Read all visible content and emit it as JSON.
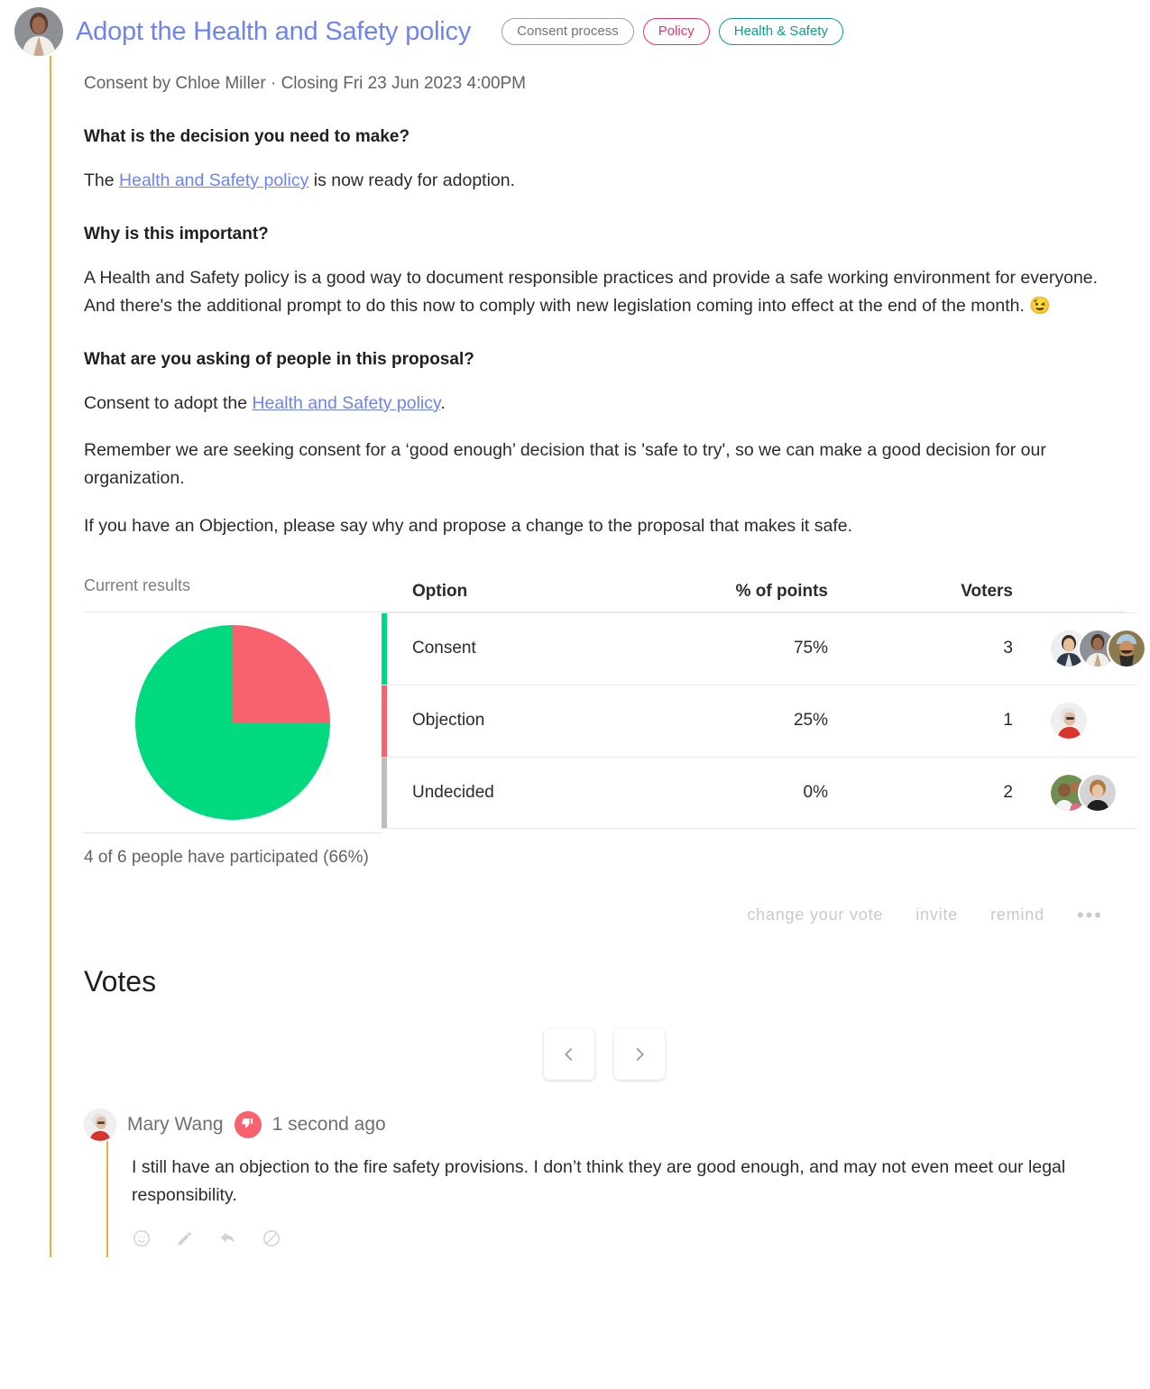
{
  "header": {
    "title": "Adopt the Health and Safety policy",
    "author_avatar": "woman-in-white-blazer-avatar",
    "tags": [
      {
        "label": "Consent process",
        "style": "gray"
      },
      {
        "label": "Policy",
        "style": "pink"
      },
      {
        "label": "Health & Safety",
        "style": "teal"
      }
    ]
  },
  "meta": "Consent by Chloe Miller · Closing Fri 23 Jun 2023 4:00PM",
  "content": {
    "q1_heading": "What is the decision you need to make?",
    "p1_before": "The ",
    "p1_link": "Health and Safety policy",
    "p1_after": " is now ready for adoption.",
    "q2_heading": "Why is this important?",
    "p2": "A Health and Safety policy is a good way to document responsible practices and provide a safe working environment for everyone. And there's the additional prompt to do this now to comply with new legislation coming into effect at the end of the month. ",
    "p2_emoji": "😉",
    "q3_heading": "What are you asking of people in this proposal?",
    "p3_before": "Consent to adopt the ",
    "p3_link": "Health and Safety policy",
    "p3_after": ".",
    "p4": "Remember we are seeking consent for a ‘good enough’ decision that is 'safe to try', so we can make a good decision for our organization.",
    "p5": "If you have an Objection, please say why and propose a change to the proposal that makes it safe."
  },
  "results": {
    "label": "Current results",
    "columns": {
      "option": "Option",
      "percent": "% of points",
      "voters": "Voters"
    },
    "rows": [
      {
        "option": "Consent",
        "percent": "75%",
        "voters": "3",
        "color": "#00d97e",
        "avatars": [
          "asian-man-avatar",
          "woman-in-white-blazer-avatar",
          "man-with-turban-avatar"
        ]
      },
      {
        "option": "Objection",
        "percent": "25%",
        "voters": "1",
        "color": "#f8616e",
        "avatars": [
          "older-woman-with-glasses-avatar"
        ]
      },
      {
        "option": "Undecided",
        "percent": "0%",
        "voters": "2",
        "color": "#bdbdbd",
        "avatars": [
          "man-with-child-avatar",
          "short-haired-woman-avatar"
        ]
      }
    ],
    "participation": "4 of 6 people have participated (66%)",
    "actions": [
      {
        "label": "change your vote",
        "name": "change-your-vote-button"
      },
      {
        "label": "invite",
        "name": "invite-button"
      },
      {
        "label": "remind",
        "name": "remind-button"
      }
    ],
    "more_label": "•••"
  },
  "chart_data": {
    "type": "pie",
    "title": "Current results",
    "labels": [
      "Consent",
      "Objection",
      "Undecided"
    ],
    "values": [
      75,
      25,
      0
    ],
    "colors": [
      "#00d97e",
      "#f8616e",
      "#bdbdbd"
    ],
    "unit": "% of points",
    "voter_counts": [
      3,
      1,
      2
    ],
    "legend": "table",
    "start_angle_deg": 0,
    "direction": "counterclockwise",
    "participation_count": 4,
    "participation_total": 6,
    "participation_pct": 66
  },
  "votes": {
    "heading": "Votes",
    "pager": {
      "prev": "previous-page",
      "next": "next-page"
    },
    "comments": [
      {
        "author": "Mary Wang",
        "avatar": "older-woman-with-glasses-avatar",
        "vote_icon": "thumbs-down-icon",
        "vote_color": "#f8616e",
        "time": "1 second ago",
        "text": "I still have an objection to the fire safety provisions. I don’t think they are good enough, and may not even meet our legal responsibility.",
        "tools": [
          "emoji-react-icon",
          "edit-icon",
          "reply-icon",
          "block-icon"
        ]
      }
    ]
  }
}
